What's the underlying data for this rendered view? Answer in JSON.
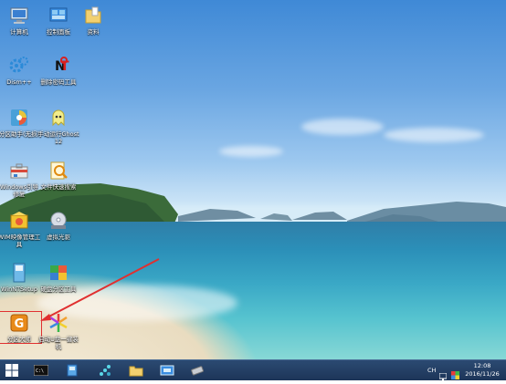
{
  "desktop": {
    "icons": [
      {
        "label": "计算机"
      },
      {
        "label": "控制面板"
      },
      {
        "label": "资料"
      },
      {
        "label": "Dism++"
      },
      {
        "label": "删除密码工具"
      },
      {
        "label": "分区助手(无损)"
      },
      {
        "label": "手动运行Ghost12"
      },
      {
        "label": "Windows引导修复"
      },
      {
        "label": "文件快速搜索"
      },
      {
        "label": "WIM映像管理工具"
      },
      {
        "label": "虚拟光驱"
      },
      {
        "label": "WinNTSetup"
      },
      {
        "label": "硬盘分区工具"
      },
      {
        "label": "分区大师"
      },
      {
        "label": "启动U盘一键装机"
      }
    ]
  },
  "taskbar": {
    "lang": "CH",
    "time": "12:08",
    "date": "2016/11/26",
    "colors": {
      "bar": "#1d3558",
      "highlight": "#e03030"
    },
    "items": [
      "start-icon",
      "cmd-icon",
      "disk-tool-icon",
      "network-tool-icon",
      "folder-icon",
      "screen-capture-icon",
      "usb-drive-icon"
    ]
  }
}
